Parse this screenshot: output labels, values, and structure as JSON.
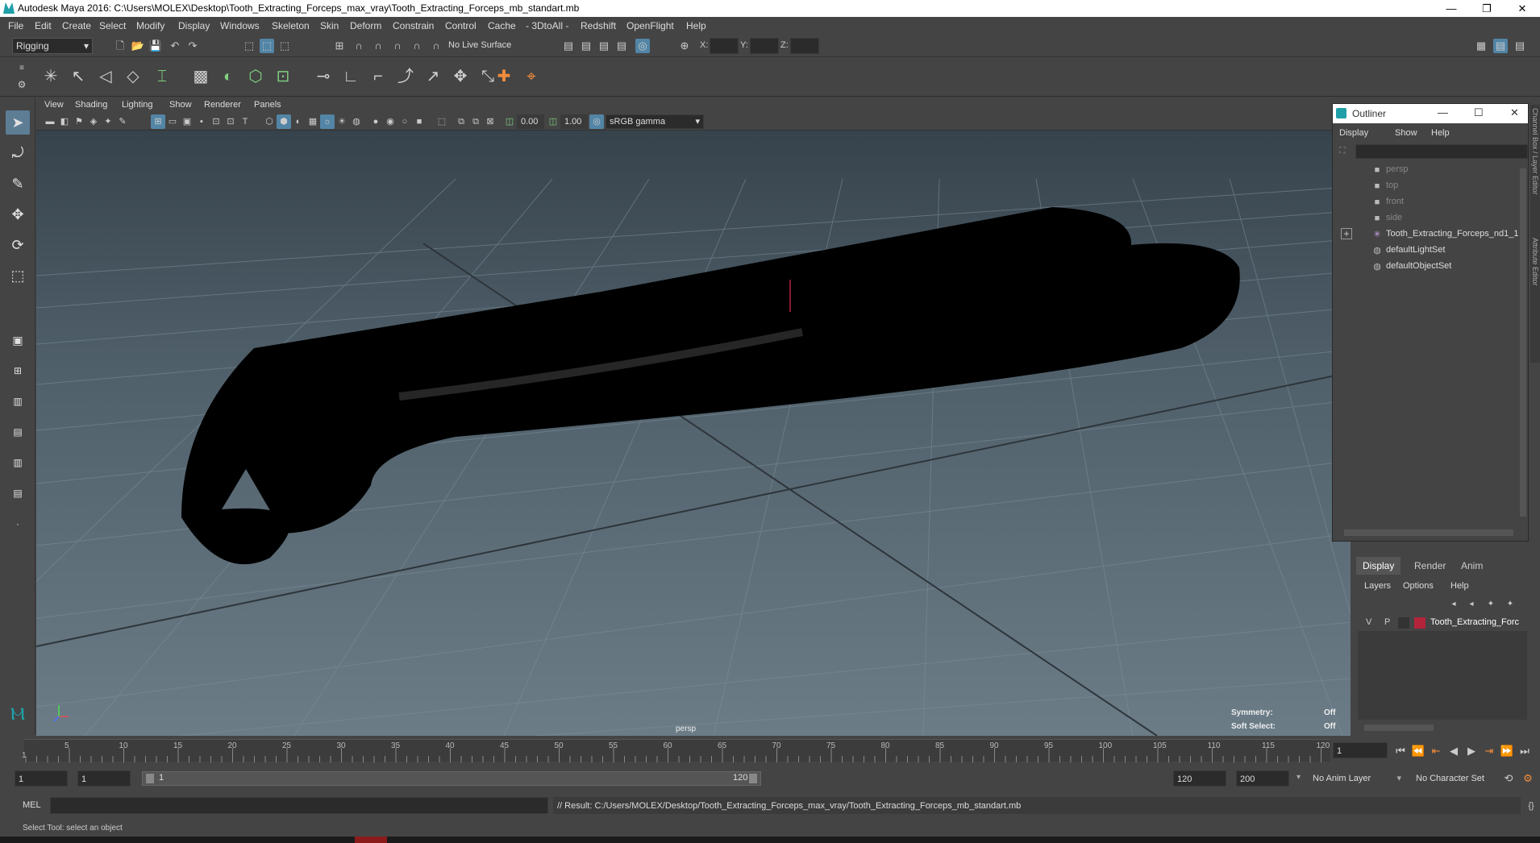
{
  "window": {
    "title": "Autodesk Maya 2016: C:\\Users\\MOLEX\\Desktop\\Tooth_Extracting_Forceps_max_vray\\Tooth_Extracting_Forceps_mb_standart.mb",
    "minimize": "—",
    "restore": "❐",
    "close": "✕"
  },
  "menubar": [
    "File",
    "Edit",
    "Create",
    "Select",
    "Modify",
    "Display",
    "Windows",
    "Skeleton",
    "Skin",
    "Deform",
    "Constrain",
    "Control",
    "Cache",
    "- 3DtoAll -",
    "Redshift",
    "OpenFlight",
    "Help"
  ],
  "statusline": {
    "menu_set": "Rigging",
    "live_surface": "No Live Surface",
    "x_label": "X:",
    "y_label": "Y:",
    "z_label": "Z:"
  },
  "panel_menu": [
    "View",
    "Shading",
    "Lighting",
    "Show",
    "Renderer",
    "Panels"
  ],
  "panel_tools": {
    "exposure": "0.00",
    "gamma": "1.00",
    "color_space": "sRGB gamma"
  },
  "viewport": {
    "camera_label": "persp",
    "symmetry_label": "Symmetry:",
    "symmetry_value": "Off",
    "soft_select_label": "Soft Select:",
    "soft_select_value": "Off"
  },
  "outliner": {
    "title": "Outliner",
    "menu": [
      "Display",
      "Show",
      "Help"
    ],
    "items": [
      {
        "label": "persp",
        "icon": "camera-icon",
        "dim": true
      },
      {
        "label": "top",
        "icon": "camera-icon",
        "dim": true
      },
      {
        "label": "front",
        "icon": "camera-icon",
        "dim": true
      },
      {
        "label": "side",
        "icon": "camera-icon",
        "dim": true
      },
      {
        "label": "Tooth_Extracting_Forceps_nd1_1",
        "icon": "group-icon",
        "dim": false
      },
      {
        "label": "defaultLightSet",
        "icon": "set-icon",
        "dim": false
      },
      {
        "label": "defaultObjectSet",
        "icon": "set-icon",
        "dim": false
      }
    ]
  },
  "side_tabs": {
    "channel_box": "Channel Box / Layer Editor",
    "attribute_editor": "Attribute Editor"
  },
  "layer_editor": {
    "tabs": [
      "Display",
      "Render",
      "Anim"
    ],
    "menu": [
      "Layers",
      "Options",
      "Help"
    ],
    "layer": {
      "v": "V",
      "p": "P",
      "name": "Tooth_Extracting_Forc",
      "color": "#b3243b"
    }
  },
  "timeslider": {
    "ticks": [
      "5",
      "10",
      "15",
      "20",
      "25",
      "30",
      "35",
      "40",
      "45",
      "50",
      "55",
      "60",
      "65",
      "70",
      "75",
      "80",
      "85",
      "90",
      "95",
      "100",
      "105",
      "110",
      "115",
      "120"
    ],
    "first_tick": "1",
    "current_frame": "1"
  },
  "rangeslider": {
    "start": "1",
    "playback_start": "1",
    "range_start": "1",
    "range_end": "120",
    "playback_end": "120",
    "end": "200",
    "anim_layer": "No Anim Layer",
    "char_set": "No Character Set"
  },
  "cmdline": {
    "lang": "MEL",
    "result": "// Result: C:/Users/MOLEX/Desktop/Tooth_Extracting_Forceps_max_vray/Tooth_Extracting_Forceps_mb_standart.mb"
  },
  "helpline": {
    "text": "Select Tool: select an object"
  },
  "colors": {
    "ui_bg": "#444444",
    "accent": "#5285a6",
    "layer_color": "#b3243b"
  }
}
